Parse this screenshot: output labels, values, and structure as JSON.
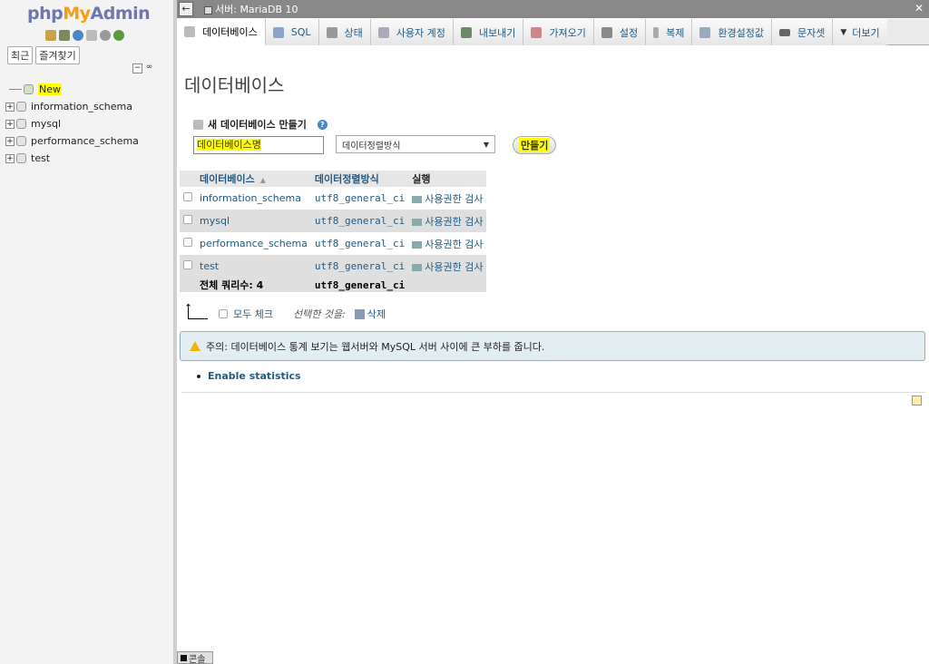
{
  "logo": {
    "php": "php",
    "my": "My",
    "admin": "Admin"
  },
  "nav": {
    "tabs": [
      "최근",
      "즐겨찾기"
    ],
    "new_label": "New",
    "databases": [
      "information_schema",
      "mysql",
      "performance_schema",
      "test"
    ]
  },
  "serverbar": {
    "label": "서버: MariaDB 10"
  },
  "menu": [
    {
      "label": "데이터베이스",
      "icon": "database-icon",
      "active": true
    },
    {
      "label": "SQL",
      "icon": "sql-icon"
    },
    {
      "label": "상태",
      "icon": "status-icon"
    },
    {
      "label": "사용자 계정",
      "icon": "users-icon"
    },
    {
      "label": "내보내기",
      "icon": "export-icon"
    },
    {
      "label": "가져오기",
      "icon": "import-icon"
    },
    {
      "label": "설정",
      "icon": "wrench-icon"
    },
    {
      "label": "복제",
      "icon": "replication-icon"
    },
    {
      "label": "환경설정값",
      "icon": "variables-icon"
    },
    {
      "label": "문자셋",
      "icon": "charset-icon"
    },
    {
      "label": "더보기",
      "icon": "chevron-down-icon"
    }
  ],
  "main": {
    "title": "데이터베이스",
    "create_label": "새 데이터베이스 만들기",
    "db_name_placeholder": "데이터베이스명",
    "collation_label": "데이터정렬방식",
    "create_button": "만들기",
    "table": {
      "headers": {
        "database": "데이터베이스",
        "collation": "데이터정렬방식",
        "action": "실행"
      },
      "rows": [
        {
          "name": "information_schema",
          "collation": "utf8_general_ci",
          "action": "사용권한 검사"
        },
        {
          "name": "mysql",
          "collation": "utf8_general_ci",
          "action": "사용권한 검사"
        },
        {
          "name": "performance_schema",
          "collation": "utf8_general_ci",
          "action": "사용권한 검사"
        },
        {
          "name": "test",
          "collation": "utf8_general_ci",
          "action": "사용권한 검사"
        }
      ],
      "total_label": "전체 쿼리수: 4",
      "total_collation": "utf8_general_ci"
    },
    "check_all": "모두 체크",
    "with_selected": "선택한 것을:",
    "delete": "삭제",
    "notice": "주의: 데이터베이스 통계 보기는 웹서버와 MySQL 서버 사이에 큰 부하를 줍니다.",
    "enable_stats": "Enable statistics"
  },
  "console": {
    "label": "콘솔"
  },
  "colors": {
    "link": "#235a81",
    "highlight": "#ffff00",
    "serverbar": "#888888"
  }
}
